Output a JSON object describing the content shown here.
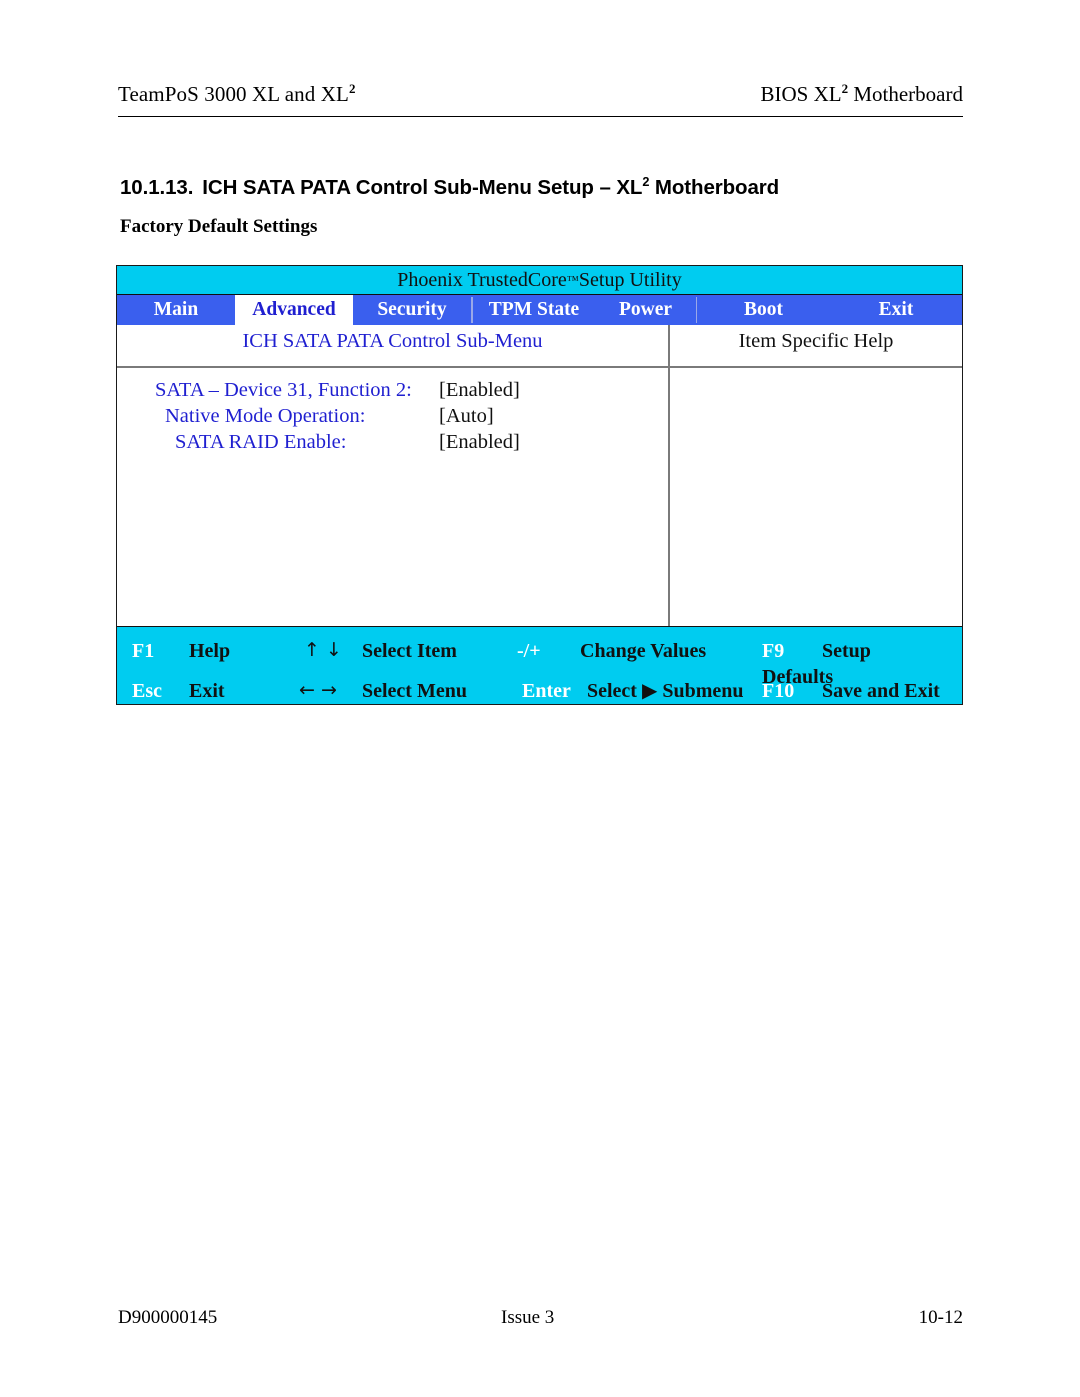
{
  "page_header": {
    "left_text_main": "TeamPoS 3000 XL and XL",
    "left_text_sup": "2",
    "right_text_main": "BIOS XL",
    "right_text_sup": "2",
    "right_text_tail": " Motherboard"
  },
  "section": {
    "number": "10.1.13.",
    "title_main": "ICH SATA PATA Control Sub-Menu Setup – XL",
    "title_sup": "2",
    "title_tail": " Motherboard",
    "subtitle": "Factory Default Settings"
  },
  "bios": {
    "utility_title_before": "Phoenix TrustedCore",
    "utility_title_tm": "™",
    "utility_title_after": " Setup Utility",
    "menu_tabs": [
      {
        "label": "Main",
        "active": false
      },
      {
        "label": "Advanced",
        "active": true
      },
      {
        "label": "Security",
        "active": false
      },
      {
        "label": "TPM State",
        "active": false
      },
      {
        "label": "Power",
        "active": false
      },
      {
        "label": "Boot",
        "active": false
      },
      {
        "label": "Exit",
        "active": false
      }
    ],
    "submenu_title": "ICH SATA PATA Control Sub-Menu",
    "help_title": "Item Specific Help",
    "settings": [
      {
        "label": "SATA – Device 31, Function 2:",
        "value": "[Enabled]",
        "indent": 0
      },
      {
        "label": "Native Mode Operation:",
        "value": "[Auto]",
        "indent": 1
      },
      {
        "label": "SATA RAID Enable:",
        "value": "[Enabled]",
        "indent": 2
      }
    ],
    "keys": {
      "f1_name": "F1",
      "f1_desc": "Help",
      "updown_glyph": "↑ ↓",
      "updown_desc": "Select Item",
      "plusminus_name": "-/+",
      "plusminus_desc": "Change Values",
      "f9_name": "F9",
      "f9_desc": "Setup",
      "f9_desc2": "Defaults",
      "esc_name": "Esc",
      "esc_desc": "Exit",
      "leftright_glyph": "← →",
      "leftright_desc": "Select Menu",
      "enter_name": "Enter",
      "enter_desc_before": "Select ",
      "enter_desc_glyph": "▶",
      "enter_desc_after": " Submenu",
      "f10_name": "F10",
      "f10_desc": "Save and Exit"
    }
  },
  "page_footer": {
    "doc_number": "D900000145",
    "issue": "Issue 3",
    "page_number": "10-12"
  },
  "colors": {
    "title_bar_cyan": "#00ccf0",
    "menu_blue": "#3a5fee",
    "label_blue": "#1f1fd0",
    "key_bar_cyan": "#00ccf0"
  }
}
